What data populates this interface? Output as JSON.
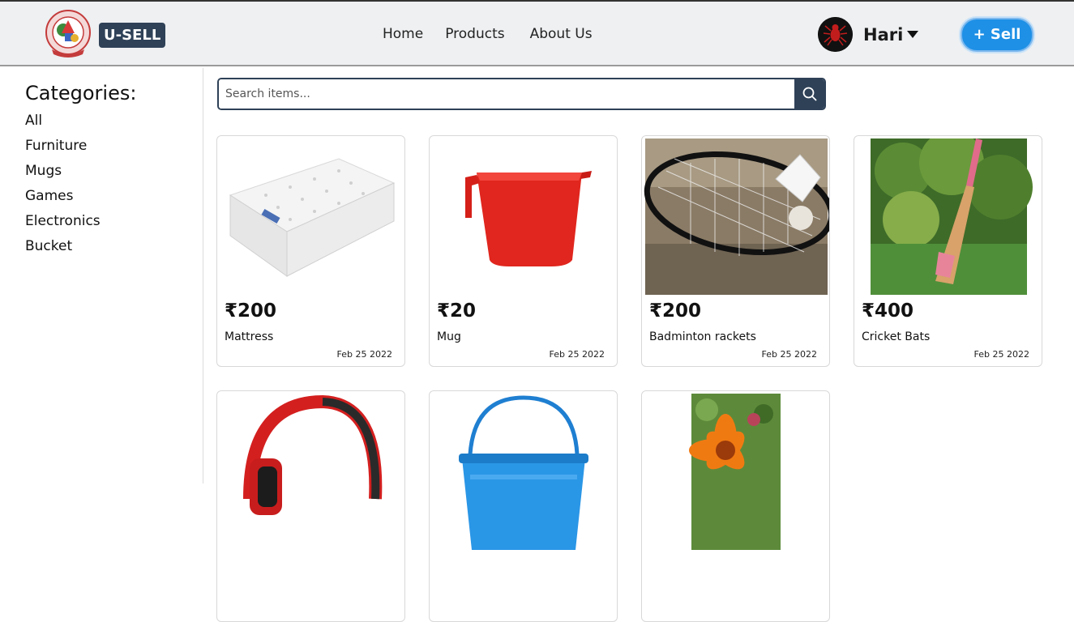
{
  "header": {
    "brand": "U-SELL",
    "nav": [
      "Home",
      "Products",
      "About Us"
    ],
    "user_name": "Hari",
    "sell_label": "+ Sell"
  },
  "sidebar": {
    "title": "Categories:",
    "items": [
      "All",
      "Furniture",
      "Mugs",
      "Games",
      "Electronics",
      "Bucket"
    ]
  },
  "search": {
    "placeholder": "Search items..."
  },
  "products": [
    {
      "price": "₹200",
      "name": "Mattress",
      "date": "Feb 25 2022",
      "icon": "mattress-image"
    },
    {
      "price": "₹20",
      "name": "Mug",
      "date": "Feb 25 2022",
      "icon": "mug-image"
    },
    {
      "price": "₹200",
      "name": "Badminton rackets",
      "date": "Feb 25 2022",
      "icon": "badminton-image"
    },
    {
      "price": "₹400",
      "name": "Cricket Bats",
      "date": "Feb 25 2022",
      "icon": "cricket-bat-image"
    },
    {
      "icon": "headphones-image"
    },
    {
      "icon": "bucket-image"
    },
    {
      "icon": "flower-image"
    }
  ],
  "colors": {
    "brand_bg": "#2e4157",
    "sell_button": "#1e90e6",
    "header_bg": "#eef0f2"
  }
}
